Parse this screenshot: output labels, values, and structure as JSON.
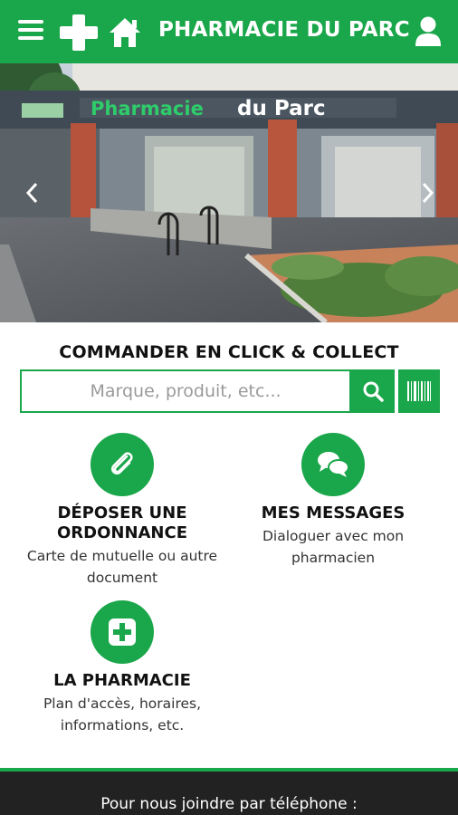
{
  "header": {
    "title": "PHARMACIE DU PARC",
    "menu_icon": "menu-icon",
    "logo_icon": "pharmacy-cross-icon",
    "home_icon": "home-icon",
    "user_icon": "user-icon",
    "color": "#1aa64a"
  },
  "hero": {
    "storefront_sign": "Pharmacie du Parc",
    "prev_icon": "chevron-left-icon",
    "next_icon": "chevron-right-icon"
  },
  "click_collect": {
    "title": "COMMANDER EN CLICK & COLLECT",
    "search_placeholder": "Marque, produit, etc...",
    "search_value": "",
    "search_icon": "search-icon",
    "barcode_icon": "barcode-icon"
  },
  "tiles": [
    {
      "title_line1": "DÉPOSER UNE",
      "title_line2": "ORDONNANCE",
      "desc_line1": "Carte de mutuelle ou autre",
      "desc_line2": "document",
      "icon": "paperclip-icon"
    },
    {
      "title_line1": "MES MESSAGES",
      "desc_line1": "Dialoguer avec mon",
      "desc_line2": "pharmacien",
      "icon": "chat-icon"
    },
    {
      "title_line1": "LA PHARMACIE",
      "desc_line1": "Plan d'accès, horaires,",
      "desc_line2": "informations, etc.",
      "icon": "plus-icon"
    }
  ],
  "footer": {
    "text": "Pour nous joindre par téléphone :"
  }
}
